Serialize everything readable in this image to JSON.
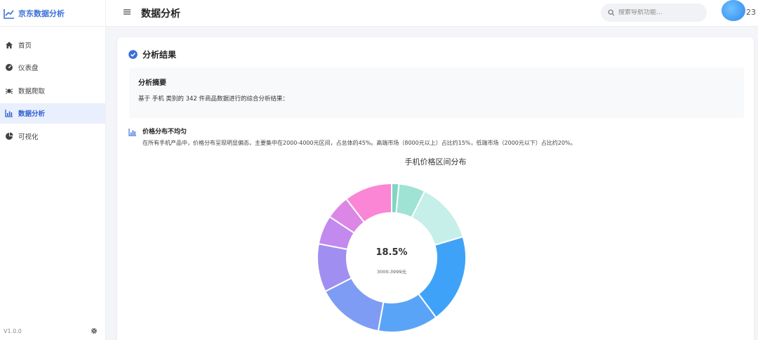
{
  "brand": {
    "name": "京东数据分析"
  },
  "sidebar": {
    "items": [
      {
        "label": "首页",
        "icon": "home-icon",
        "active": false
      },
      {
        "label": "仪表盘",
        "icon": "gauge-icon",
        "active": false
      },
      {
        "label": "数据爬取",
        "icon": "spider-icon",
        "active": false
      },
      {
        "label": "数据分析",
        "icon": "bar-chart-icon",
        "active": true
      },
      {
        "label": "可视化",
        "icon": "pie-chart-icon",
        "active": false
      }
    ],
    "version": "V1.0.0"
  },
  "header": {
    "title": "数据分析",
    "search_placeholder": "搜索导航功能...",
    "user_label": "23"
  },
  "card": {
    "title": "分析结果",
    "summary_title": "分析摘要",
    "summary_text": "基于 手机 类别的 342 件商品数据进行的综合分析结果：",
    "insight_title": "价格分布不均匀",
    "insight_text": "在所有手机产品中，价格分布呈现明显偏态，主要集中在2000-4000元区间，占总体的45%。高端市场（8000元以上）占比约15%，低端市场（2000元以下）占比约20%。"
  },
  "chart_data": {
    "type": "pie",
    "title": "手机价格区间分布",
    "center_value": "18.5%",
    "center_label": "3000-3999元",
    "slices": [
      {
        "value": 1.5,
        "color": "#7fd6c2"
      },
      {
        "value": 5.5,
        "color": "#9ee3d4"
      },
      {
        "value": 12.5,
        "color": "#c5efe8"
      },
      {
        "value": 18.5,
        "color": "#3ea3f8"
      },
      {
        "value": 12.5,
        "color": "#5aa4f7"
      },
      {
        "value": 14.0,
        "color": "#7f9cf4"
      },
      {
        "value": 10.0,
        "color": "#a08ff0"
      },
      {
        "value": 6.0,
        "color": "#c289ee"
      },
      {
        "value": 5.0,
        "color": "#dc87e6"
      },
      {
        "value": 10.0,
        "color": "#fb86d6"
      }
    ],
    "accent": "#3a6fd8"
  }
}
